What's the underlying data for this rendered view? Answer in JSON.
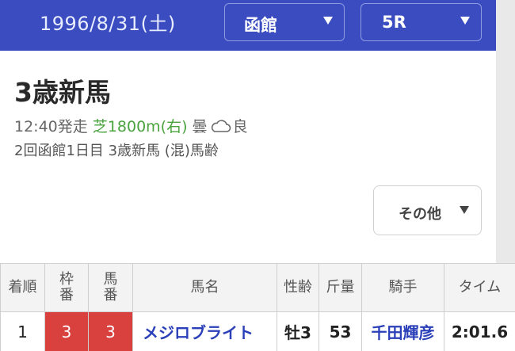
{
  "header": {
    "date": "1996/8/31",
    "weekday": "(土)",
    "venue": "函館",
    "race_no": "5R"
  },
  "race": {
    "title": "3歳新馬",
    "start_time": "12:40発走",
    "course": "芝1800m(右)",
    "weather": "曇",
    "weather_icon": "cloud-icon",
    "track_condition": "良",
    "details": "2回函館1日目 3歳新馬 (混)馬齢"
  },
  "other_button": {
    "label": "その他"
  },
  "table": {
    "headers": {
      "rank": "着順",
      "waku_1": "枠",
      "waku_2": "番",
      "uma_1": "馬",
      "uma_2": "番",
      "horse": "馬名",
      "sex_age": "性齢",
      "weight": "斤量",
      "jockey": "騎手",
      "time": "タイム"
    },
    "rows": [
      {
        "rank": "1",
        "waku": "3",
        "uma": "3",
        "horse": "メジロブライト",
        "sex_age": "牡3",
        "weight": "53",
        "jockey": "千田輝彦",
        "time": "2:01.6"
      }
    ]
  },
  "colors": {
    "header_bg": "#3a4cc0",
    "course_green": "#4aa33e",
    "waku_red": "#d9413f",
    "link_blue": "#2a3fb8"
  }
}
